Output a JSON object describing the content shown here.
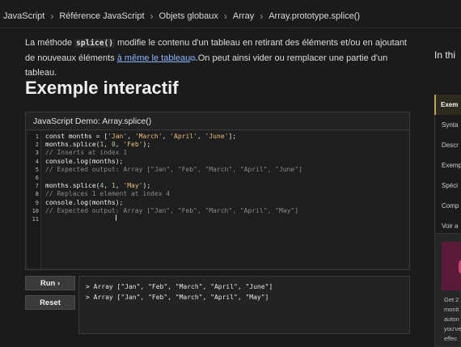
{
  "breadcrumb": [
    "JavaScript",
    "Référence JavaScript",
    "Objets globaux",
    "Array",
    "Array.prototype.splice()"
  ],
  "intro": {
    "part1": "La méthode ",
    "code": "splice()",
    "part2": " modifie le contenu d'un tableau en retirant des éléments et/ou en ajoutant de nouveaux éléments ",
    "link": "à même le tableau",
    "part3": ".On peut ainsi vider ou remplacer une partie d'un tableau."
  },
  "heading": "Exemple interactif",
  "demo": {
    "title": "JavaScript Demo: Array.splice()",
    "line_numbers": [
      "1",
      "2",
      "3",
      "4",
      "5",
      "6",
      "7",
      "8",
      "9",
      "10",
      "11"
    ],
    "run_label": "Run ›",
    "reset_label": "Reset"
  },
  "console": [
    "> Array [\"Jan\", \"Feb\", \"March\", \"April\", \"June\"]",
    "> Array [\"Jan\", \"Feb\", \"March\", \"April\", \"May\"]"
  ],
  "sidebar": {
    "title": "In thi",
    "toc": [
      "Exem",
      "Synta",
      "Descr",
      "Exemp",
      "Spéci",
      "Comp",
      "Voir a"
    ],
    "ad_text": "Get 2\nmonit\nauton\nyou've\neffec"
  },
  "colors": {
    "link": "#8cb4ff",
    "string": "#e8c07d",
    "comment": "#8a8a8a",
    "toc_active": "#c2a15a"
  }
}
